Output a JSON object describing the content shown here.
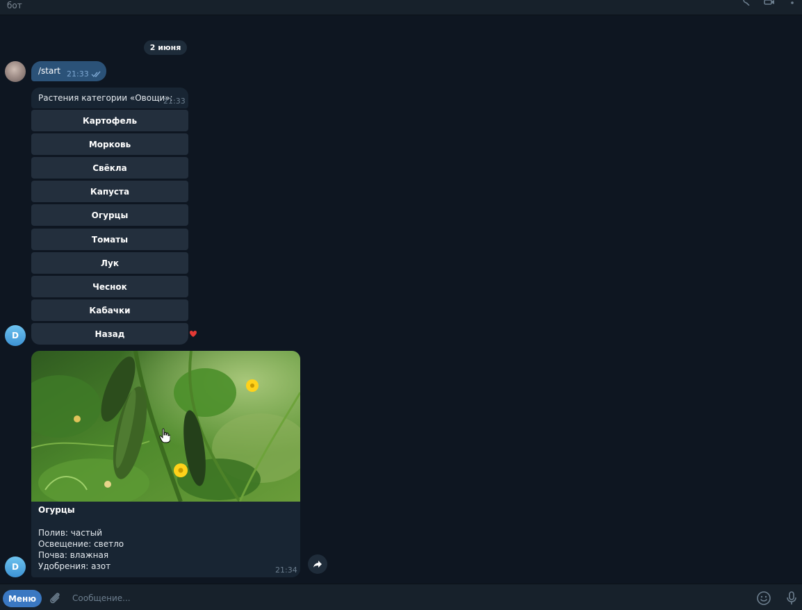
{
  "header": {
    "title": "бот"
  },
  "chat": {
    "date_separator": "2 июня",
    "outgoing": {
      "text": "/start",
      "time": "21:33"
    },
    "bot_message": {
      "text": "Растения категории «Овощи»:",
      "time": "21:33",
      "buttons": [
        "Картофель",
        "Морковь",
        "Свёкла",
        "Капуста",
        "Огурцы",
        "Томаты",
        "Лук",
        "Чеснок",
        "Кабачки",
        "Назад"
      ],
      "reaction": "heart-icon"
    },
    "photo_message": {
      "title": "Огурцы",
      "lines": [
        "Полив: частый",
        "Освещение: светло",
        "Почва: влажная",
        "Удобрения: азот"
      ],
      "time": "21:34"
    },
    "bot_avatar_letter": "D"
  },
  "composer": {
    "menu_label": "Меню",
    "placeholder": "Сообщение..."
  },
  "colors": {
    "background": "#0e1621",
    "outgoing_bubble": "#2b5278",
    "incoming_bubble": "#182533",
    "keyboard_button": "#232f3d",
    "accent": "#3a78c2"
  }
}
